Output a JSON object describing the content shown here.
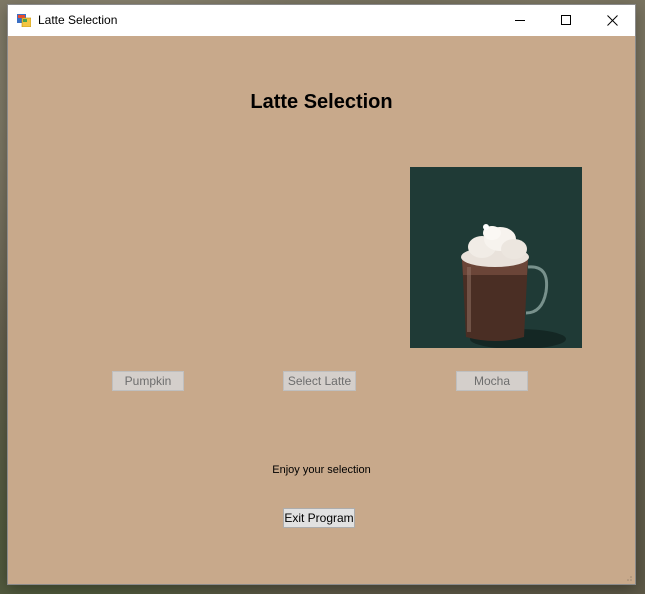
{
  "window": {
    "title": "Latte Selection",
    "background": "#c8a98b"
  },
  "caption_buttons": {
    "minimize_icon": "minimize-icon",
    "maximize_icon": "maximize-icon",
    "close_icon": "close-icon"
  },
  "main": {
    "heading": "Latte Selection",
    "photo_subject": "hot mocha with whipped cream",
    "status_text": "Enjoy your selection"
  },
  "buttons": {
    "pumpkin_label": "Pumpkin",
    "select_label": "Select Latte",
    "mocha_label": "Mocha",
    "exit_label": "Exit Program"
  }
}
